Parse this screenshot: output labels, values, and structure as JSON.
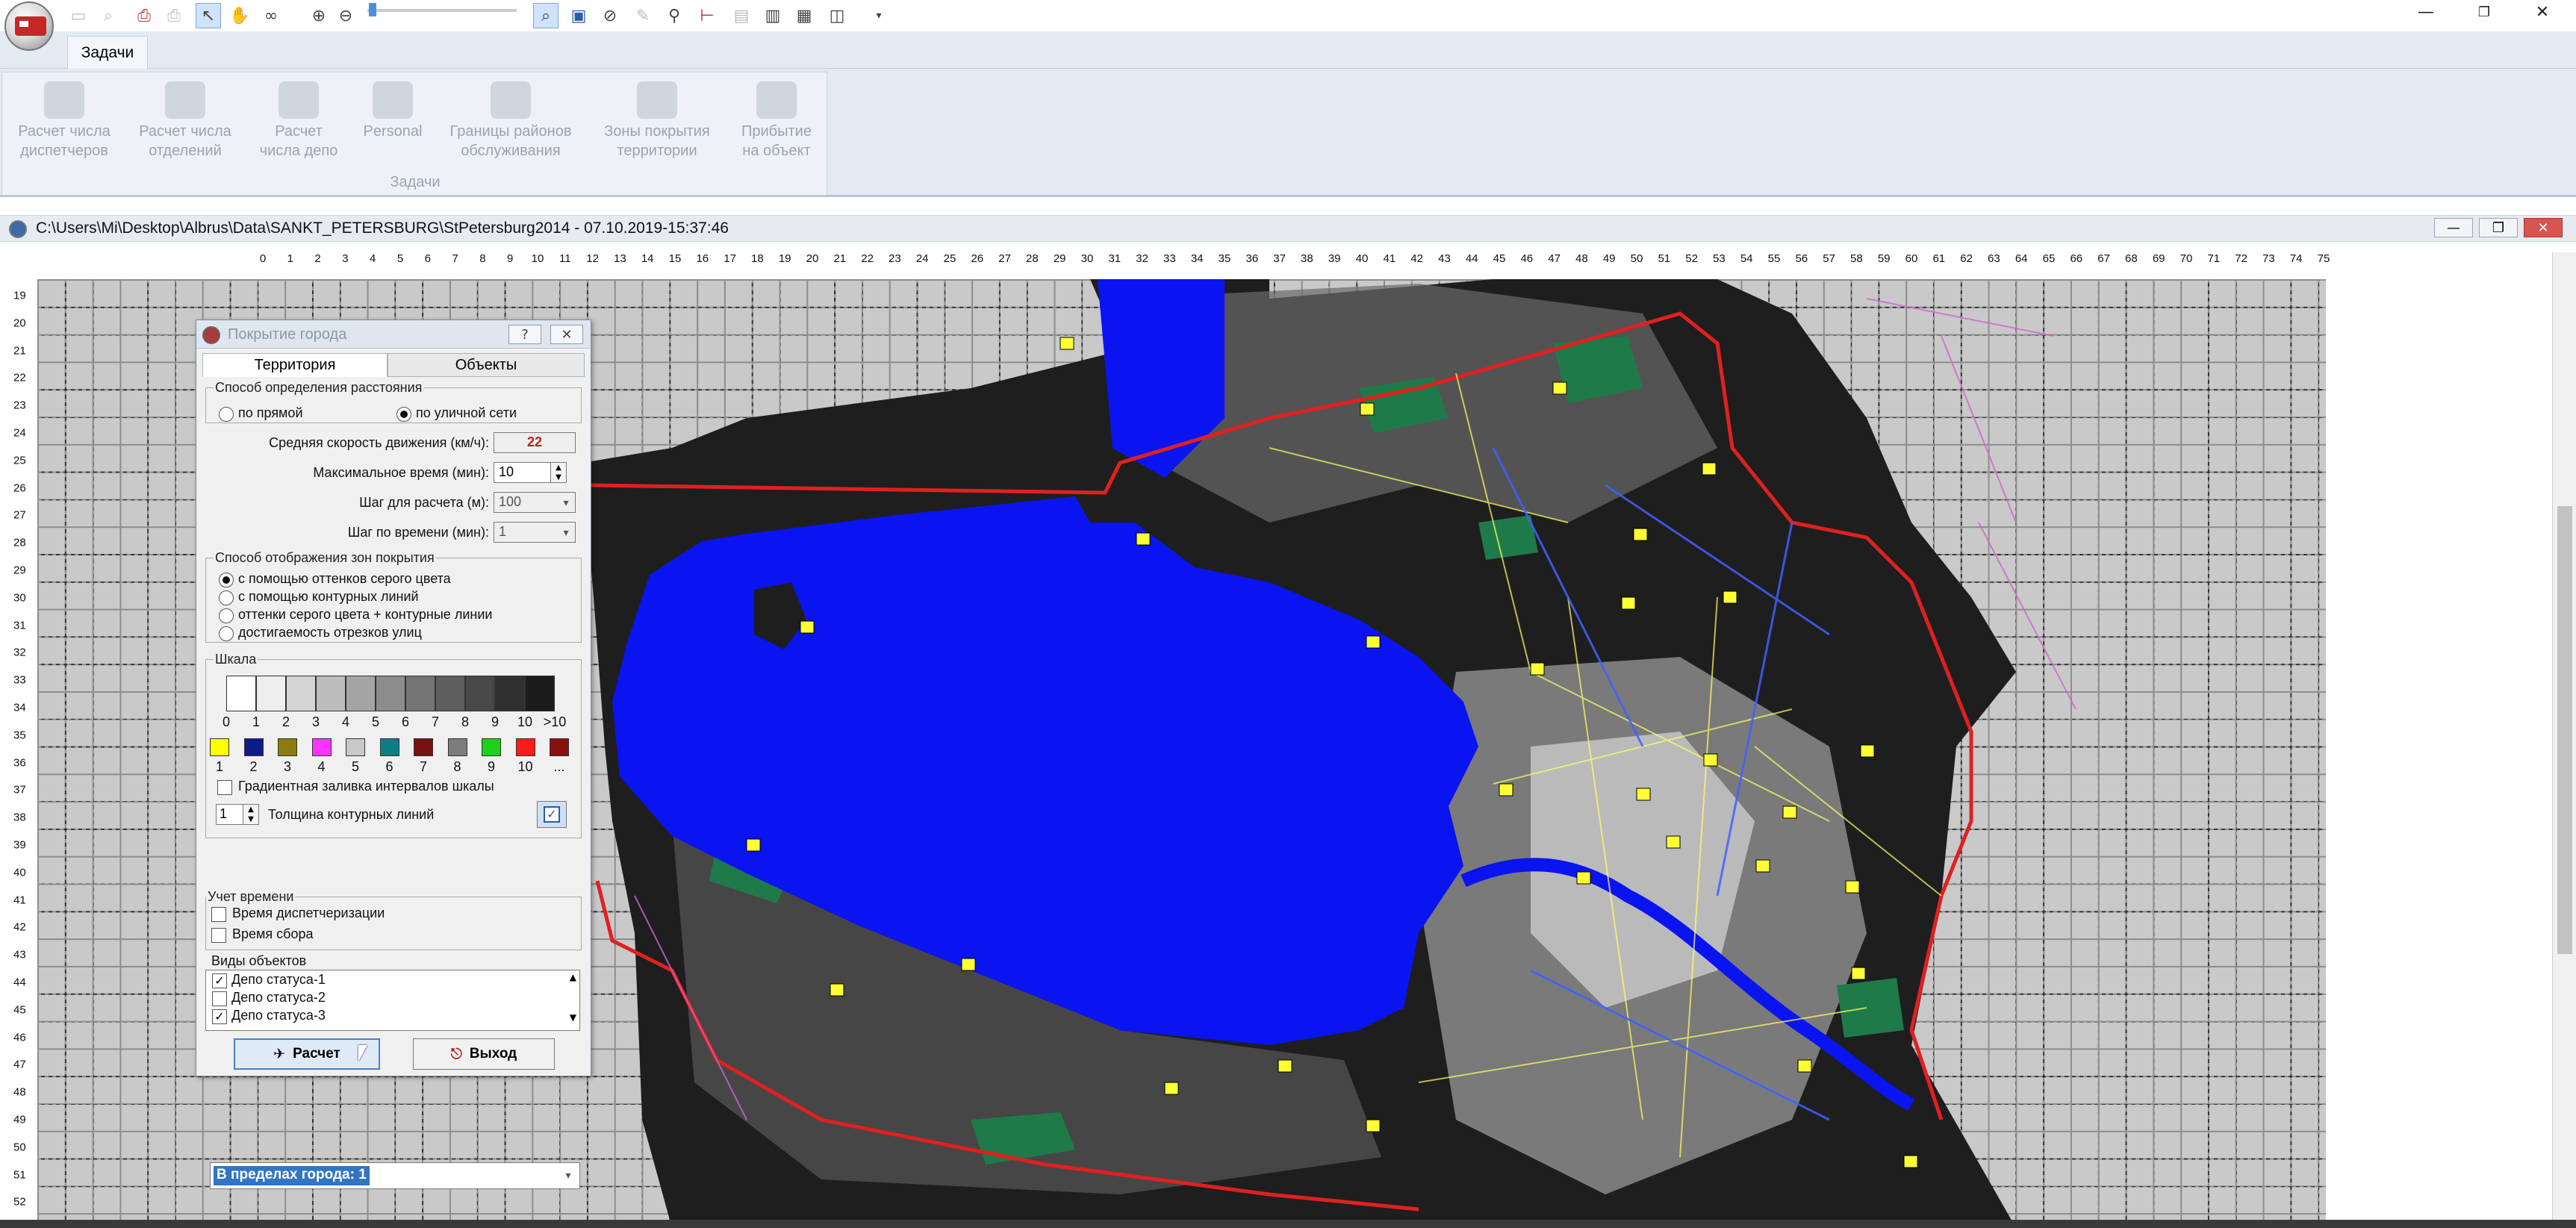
{
  "ribbon": {
    "tab": "Задачи",
    "group_label": "Задачи",
    "buttons": [
      {
        "line1": "Расчет числа",
        "line2": "диспетчеров"
      },
      {
        "line1": "Расчет числа",
        "line2": "отделений"
      },
      {
        "line1": "Расчет",
        "line2": "числа депо"
      },
      {
        "line1": "Personal",
        "line2": ""
      },
      {
        "line1": "Границы районов",
        "line2": "обслуживания"
      },
      {
        "line1": "Зоны покрытия",
        "line2": "территории"
      },
      {
        "line1": "Прибытие",
        "line2": "на объект"
      }
    ]
  },
  "document": {
    "title": "C:\\Users\\Mi\\Desktop\\Albrus\\Data\\SANKT_PETERSBURG\\StPetersburg2014 - 07.10.2019-15:37:46"
  },
  "ruler": {
    "x_ticks": [
      "0",
      "1",
      "2",
      "3",
      "4",
      "5",
      "6",
      "7",
      "8",
      "9",
      "10",
      "11",
      "12",
      "13",
      "14",
      "15",
      "16",
      "17",
      "18",
      "19",
      "20",
      "21",
      "22",
      "23",
      "24",
      "25",
      "26",
      "27",
      "28",
      "29",
      "30",
      "31",
      "32",
      "33",
      "34",
      "35",
      "36",
      "37",
      "38",
      "39",
      "40",
      "41",
      "42",
      "43",
      "44",
      "45",
      "46",
      "47",
      "48",
      "49",
      "50",
      "51",
      "52",
      "53",
      "54",
      "55",
      "56",
      "57",
      "58",
      "59",
      "60",
      "61",
      "62",
      "63",
      "64",
      "65",
      "66",
      "67",
      "68",
      "69",
      "70",
      "71",
      "72",
      "73",
      "74",
      "75"
    ],
    "y_ticks": [
      "19",
      "20",
      "21",
      "22",
      "23",
      "24",
      "25",
      "26",
      "27",
      "28",
      "29",
      "30",
      "31",
      "32",
      "33",
      "34",
      "35",
      "36",
      "37",
      "38",
      "39",
      "40",
      "41",
      "42",
      "43",
      "44",
      "45",
      "46",
      "47",
      "48",
      "49",
      "50",
      "51",
      "52"
    ]
  },
  "dialog": {
    "title": "Покрытие города",
    "help": "?",
    "tabs": [
      "Территория",
      "Объекты"
    ],
    "distance": {
      "legend": "Способ определения расстояния",
      "options": [
        "по прямой",
        "по уличной сети"
      ],
      "selected": 1
    },
    "avg_speed_label": "Средняя скорость движения (км/ч):",
    "avg_speed": "22",
    "max_time_label": "Максимальное время (мин):",
    "max_time": "10",
    "step_label": "Шаг для расчета (м):",
    "step": "100",
    "time_step_label": "Шаг по времени (мин):",
    "time_step": "1",
    "display": {
      "legend": "Способ отображения зон покрытия",
      "options": [
        "с помощью оттенков серого цвета",
        "с помощью контурных линий",
        "оттенки серого цвета + контурные линии",
        "достигаемость отрезков улиц"
      ],
      "selected": 0
    },
    "scale": {
      "legend": "Шкала",
      "gray_labels": [
        "0",
        "1",
        "2",
        "3",
        "4",
        "5",
        "6",
        "7",
        "8",
        "9",
        "10",
        ">10"
      ],
      "gray_colors": [
        "#ffffff",
        "#eeeeee",
        "#d4d4d4",
        "#bcbcbc",
        "#a4a4a4",
        "#8c8c8c",
        "#747474",
        "#5e5e5e",
        "#484848",
        "#303030",
        "#1c1c1c"
      ],
      "color_labels": [
        "1",
        "2",
        "3",
        "4",
        "5",
        "6",
        "7",
        "8",
        "9",
        "10",
        "..."
      ],
      "colors": [
        "#ffff00",
        "#101b8a",
        "#8a7d10",
        "#ff33ff",
        "#c8c8c8",
        "#0a7f83",
        "#7a1010",
        "#7c7c7c",
        "#19d219",
        "#ff1a1a",
        "#8a1010"
      ],
      "gradient_label": "Градиентная заливка интервалов шкалы",
      "gradient_checked": false,
      "thickness_value": "1",
      "thickness_label": "Толщина контурных линий"
    },
    "area_select": "В пределах города: 1",
    "time_account": {
      "legend": "Учет времени",
      "items": [
        "Время диспетчеризации",
        "Время сбора"
      ]
    },
    "objects": {
      "legend": "Виды объектов",
      "items": [
        {
          "label": "Депо статуса-1",
          "checked": true
        },
        {
          "label": "Депо статуса-2",
          "checked": false
        },
        {
          "label": "Депо статуса-3",
          "checked": true
        }
      ]
    },
    "calc_button": "Расчет",
    "exit_button": "Выход"
  },
  "colors": {
    "water": "#0a14f0",
    "land_dark": "#1e1e1e",
    "green": "#1f7a4a",
    "boundary": "#e02020"
  }
}
